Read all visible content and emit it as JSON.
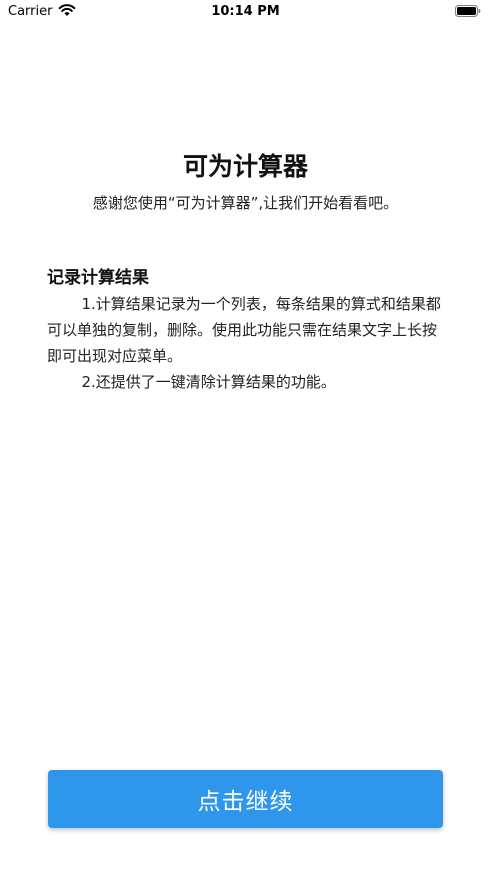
{
  "status_bar": {
    "carrier": "Carrier",
    "time": "10:14 PM",
    "wifi_icon": "wifi-icon",
    "battery_icon": "battery-icon"
  },
  "header": {
    "title": "可为计算器",
    "subtitle": "感谢您使用“可为计算器”,让我们开始看看吧。"
  },
  "feature": {
    "heading": "记录计算结果",
    "paragraphs": [
      "1.计算结果记录为一个列表，每条结果的算式和结果都可以单独的复制，删除。使用此功能只需在结果文字上长按即可出现对应菜单。",
      "2.还提供了一键清除计算结果的功能。"
    ]
  },
  "actions": {
    "continue_label": "点击继续"
  },
  "colors": {
    "button_background": "#2e97ec",
    "button_text": "#ffffff",
    "page_background": "#ffffff"
  }
}
